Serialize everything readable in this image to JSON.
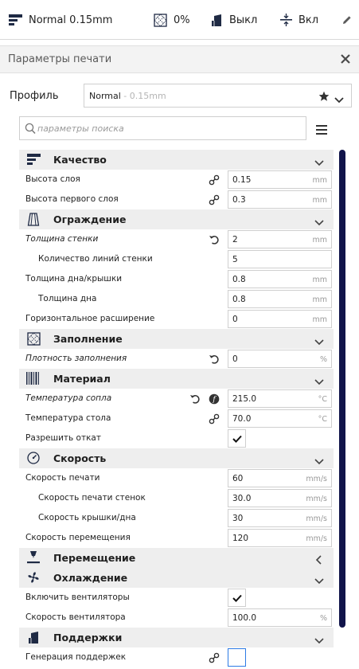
{
  "toolbar": {
    "profile_label": "Normal 0.15mm",
    "infill_value": "0%",
    "support_value": "Выкл",
    "adhesion_value": "Вкл"
  },
  "panel": {
    "title": "Параметры печати"
  },
  "profile": {
    "label": "Профиль",
    "name": "Normal",
    "subtitle": " - 0.15mm"
  },
  "search": {
    "placeholder": "параметры поиска"
  },
  "categories": {
    "quality": "Качество",
    "walls": "Ограждение",
    "infill": "Заполнение",
    "material": "Материал",
    "speed": "Скорость",
    "travel": "Перемещение",
    "cooling": "Охлаждение",
    "support": "Поддержки"
  },
  "settings": {
    "layer_height": {
      "label": "Высота слоя",
      "value": "0.15",
      "unit": "mm"
    },
    "initial_layer_height": {
      "label": "Высота первого слоя",
      "value": "0.3",
      "unit": "mm"
    },
    "wall_thickness": {
      "label": "Толщина стенки",
      "value": "2",
      "unit": "mm"
    },
    "wall_line_count": {
      "label": "Количество линий стенки",
      "value": "5",
      "unit": ""
    },
    "top_bottom_thickness": {
      "label": "Толщина дна/крышки",
      "value": "0.8",
      "unit": "mm"
    },
    "bottom_thickness": {
      "label": "Толщина дна",
      "value": "0.8",
      "unit": "mm"
    },
    "horizontal_expansion": {
      "label": "Горизонтальное расширение",
      "value": "0",
      "unit": "mm"
    },
    "infill_density": {
      "label": "Плотность заполнения",
      "value": "0",
      "unit": "%"
    },
    "nozzle_temp": {
      "label": "Температура сопла",
      "value": "215.0",
      "unit": "°C"
    },
    "bed_temp": {
      "label": "Температура стола",
      "value": "70.0",
      "unit": "°C"
    },
    "retraction": {
      "label": "Разрешить откат",
      "checked": true
    },
    "print_speed": {
      "label": "Скорость печати",
      "value": "60",
      "unit": "mm/s"
    },
    "wall_speed": {
      "label": "Скорость печати стенок",
      "value": "30.0",
      "unit": "mm/s"
    },
    "topbottom_speed": {
      "label": "Скорость крышки/дна",
      "value": "30",
      "unit": "mm/s"
    },
    "travel_speed": {
      "label": "Скорость перемещения",
      "value": "120",
      "unit": "mm/s"
    },
    "enable_fans": {
      "label": "Включить вентиляторы",
      "checked": true
    },
    "fan_speed": {
      "label": "Скорость вентилятора",
      "value": "100.0",
      "unit": "%"
    },
    "generate_support": {
      "label": "Генерация поддержек",
      "checked": false
    }
  },
  "colors": {
    "accent": "#2d7be5",
    "scrollbar": "#11144a",
    "category_bg": "#eeeeee"
  }
}
